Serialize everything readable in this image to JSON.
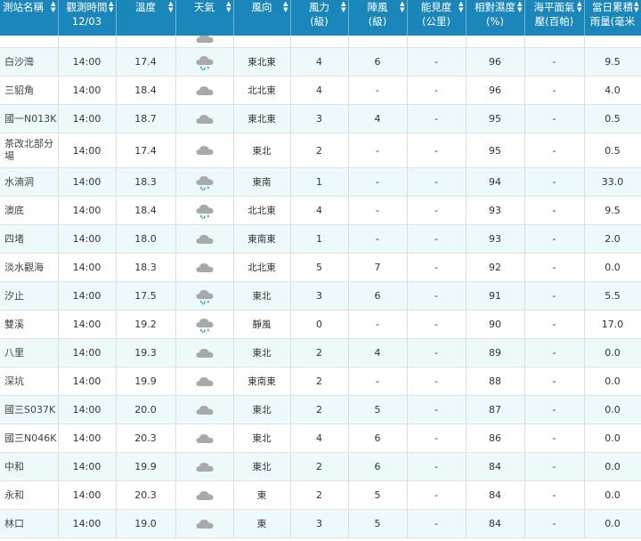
{
  "headers": [
    {
      "l1": "測站名稱",
      "l2": ""
    },
    {
      "l1": "觀測時間",
      "l2": "12/03"
    },
    {
      "l1": "溫度",
      "l2": ""
    },
    {
      "l1": "天氣",
      "l2": ""
    },
    {
      "l1": "風向",
      "l2": ""
    },
    {
      "l1": "風力",
      "l2": "(級)"
    },
    {
      "l1": "陣風",
      "l2": "(級)"
    },
    {
      "l1": "能見度",
      "l2": "(公里)"
    },
    {
      "l1": "相對濕度",
      "l2": "(%)"
    },
    {
      "l1": "海平面氣",
      "l2": "壓(百帕)"
    },
    {
      "l1": "當日累積",
      "l2": "雨量(毫米"
    }
  ],
  "rows": [
    {
      "station": "白沙灣",
      "time": "14:00",
      "temp": "17.4",
      "weather": "rain-cloud-icon",
      "dir": "東北東",
      "wind": "4",
      "gust": "6",
      "vis": "-",
      "hum": "96",
      "pres": "-",
      "rain": "9.5"
    },
    {
      "station": "三貂角",
      "time": "14:00",
      "temp": "18.4",
      "weather": "cloud-icon",
      "dir": "北北東",
      "wind": "4",
      "gust": "-",
      "vis": "-",
      "hum": "96",
      "pres": "-",
      "rain": "4.0"
    },
    {
      "station": "國一N013K",
      "time": "14:00",
      "temp": "18.7",
      "weather": "cloud-icon",
      "dir": "東北東",
      "wind": "3",
      "gust": "4",
      "vis": "-",
      "hum": "95",
      "pres": "-",
      "rain": "0.5"
    },
    {
      "station": "茶改北部分場",
      "time": "14:00",
      "temp": "17.4",
      "weather": "cloud-icon",
      "dir": "東北",
      "wind": "2",
      "gust": "-",
      "vis": "-",
      "hum": "95",
      "pres": "-",
      "rain": "0.5"
    },
    {
      "station": "水湳洞",
      "time": "14:00",
      "temp": "18.3",
      "weather": "rain-cloud-icon",
      "dir": "東南",
      "wind": "1",
      "gust": "-",
      "vis": "-",
      "hum": "94",
      "pres": "-",
      "rain": "33.0"
    },
    {
      "station": "澳底",
      "time": "14:00",
      "temp": "18.4",
      "weather": "rain-cloud-icon",
      "dir": "北北東",
      "wind": "4",
      "gust": "-",
      "vis": "-",
      "hum": "93",
      "pres": "-",
      "rain": "9.5"
    },
    {
      "station": "四堵",
      "time": "14:00",
      "temp": "18.0",
      "weather": "cloud-icon",
      "dir": "東南東",
      "wind": "1",
      "gust": "-",
      "vis": "-",
      "hum": "93",
      "pres": "-",
      "rain": "2.0"
    },
    {
      "station": "淡水觀海",
      "time": "14:00",
      "temp": "18.3",
      "weather": "cloud-icon",
      "dir": "北北東",
      "wind": "5",
      "gust": "7",
      "vis": "-",
      "hum": "92",
      "pres": "-",
      "rain": "0.0"
    },
    {
      "station": "汐止",
      "time": "14:00",
      "temp": "17.5",
      "weather": "rain-cloud-icon",
      "dir": "東北",
      "wind": "3",
      "gust": "6",
      "vis": "-",
      "hum": "91",
      "pres": "-",
      "rain": "5.5"
    },
    {
      "station": "雙溪",
      "time": "14:00",
      "temp": "19.2",
      "weather": "rain-cloud-icon",
      "dir": "靜風",
      "wind": "0",
      "gust": "-",
      "vis": "-",
      "hum": "90",
      "pres": "-",
      "rain": "17.0"
    },
    {
      "station": "八里",
      "time": "14:00",
      "temp": "19.3",
      "weather": "cloud-icon",
      "dir": "東北",
      "wind": "2",
      "gust": "4",
      "vis": "-",
      "hum": "89",
      "pres": "-",
      "rain": "0.0"
    },
    {
      "station": "深坑",
      "time": "14:00",
      "temp": "19.9",
      "weather": "cloud-icon",
      "dir": "東南東",
      "wind": "2",
      "gust": "-",
      "vis": "-",
      "hum": "88",
      "pres": "-",
      "rain": "0.0"
    },
    {
      "station": "國三S037K",
      "time": "14:00",
      "temp": "20.0",
      "weather": "cloud-icon",
      "dir": "東北",
      "wind": "2",
      "gust": "5",
      "vis": "-",
      "hum": "87",
      "pres": "-",
      "rain": "0.0"
    },
    {
      "station": "國三N046K",
      "time": "14:00",
      "temp": "20.3",
      "weather": "cloud-icon",
      "dir": "東北",
      "wind": "4",
      "gust": "6",
      "vis": "-",
      "hum": "86",
      "pres": "-",
      "rain": "0.0"
    },
    {
      "station": "中和",
      "time": "14:00",
      "temp": "19.9",
      "weather": "cloud-icon",
      "dir": "東北",
      "wind": "2",
      "gust": "6",
      "vis": "-",
      "hum": "84",
      "pres": "-",
      "rain": "0.0"
    },
    {
      "station": "永和",
      "time": "14:00",
      "temp": "20.3",
      "weather": "cloud-icon",
      "dir": "東",
      "wind": "2",
      "gust": "5",
      "vis": "-",
      "hum": "84",
      "pres": "-",
      "rain": "0.0"
    },
    {
      "station": "林口",
      "time": "14:00",
      "temp": "19.0",
      "weather": "cloud-icon",
      "dir": "東",
      "wind": "3",
      "gust": "5",
      "vis": "-",
      "hum": "84",
      "pres": "-",
      "rain": "0.0"
    }
  ],
  "colors": {
    "header_bg": "#1a86b9",
    "alt_row_bg": "#eef9fb",
    "cloud": "#a9a9a9",
    "rain": "#3aa0d8"
  }
}
